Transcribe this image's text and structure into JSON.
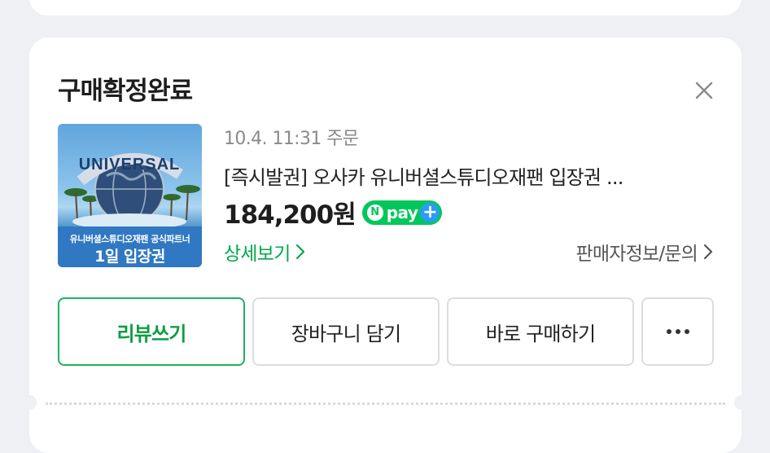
{
  "order": {
    "status": "구매확정완료",
    "date": "10.4. 11:31 주문",
    "product_name": "[즉시발권] 오사카 유니버셜스튜디오재팬 입장권 ...",
    "price": "184,200원",
    "thumbnail": {
      "caption": "유니버셜스튜디오재팬 공식파트너",
      "ticket": "1일 입장권",
      "logo_text": "UNIVERSAL"
    },
    "npay": {
      "n": "N",
      "text": "pay",
      "plus": "+"
    },
    "detail_link": "상세보기",
    "seller_link": "판매자정보/문의"
  },
  "actions": {
    "review": "리뷰쓰기",
    "cart": "장바구니 담기",
    "buy": "바로 구매하기"
  },
  "colors": {
    "accent_green": "#03c75a",
    "review_text": "#0c9e44",
    "background": "#eef0f3"
  }
}
